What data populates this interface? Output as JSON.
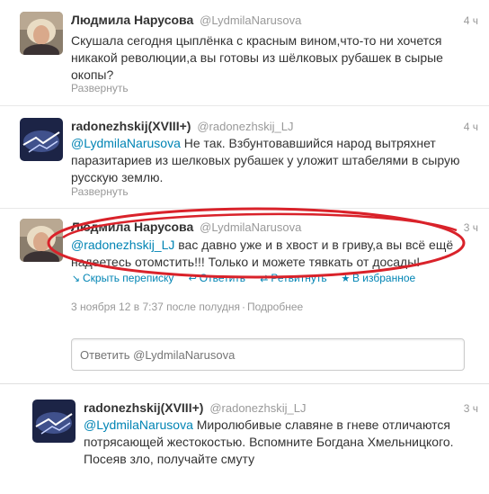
{
  "tweets": [
    {
      "fullname": "Людмила Нарусова",
      "username": "@LydmilaNarusova",
      "time": "4 ч",
      "mention": "",
      "text": "Скушала сегодня цыплёнка с красным вином,что-то ни хочется никакой революции,а вы готовы из шёлковых рубашек в сырые окопы?",
      "expand": "Развернуть"
    },
    {
      "fullname": "radonezhskij(XVIII+)",
      "username": "@radonezhskij_LJ",
      "time": "4 ч",
      "mention": "@LydmilaNarusova",
      "text": " Не так. Взбунтовавшийся народ вытряхнет паразитариев из шелковых рубашек у уложит штабелями в сырую русскую землю.",
      "expand": "Развернуть"
    },
    {
      "fullname": "Людмила Нарусова",
      "username": "@LydmilaNarusova",
      "time": "3 ч",
      "mention": "@radonezhskij_LJ",
      "text": " вас давно уже и в хвост и в гриву,а вы всё ещё надеетесь отомстить!!! Только и можете тявкать от досады!",
      "actions": {
        "hide": "Скрыть переписку",
        "reply": "Ответить",
        "retweet": "Ретвитнуть",
        "favorite": "В избранное"
      },
      "date": "3 ноября 12 в 7:37 после полудня",
      "details": "Подробнее",
      "reply_placeholder": "Ответить @LydmilaNarusova"
    },
    {
      "fullname": "radonezhskij(XVIII+)",
      "username": "@radonezhskij_LJ",
      "time": "3 ч",
      "mention": "@LydmilaNarusova",
      "text": " Миролюбивые славяне в гневе отличаются потрясающей жестокостью. Вспомните Богдана Хмельницкого. Посеяв зло, получайте смуту"
    }
  ],
  "colors": {
    "link": "#0084b4",
    "muted": "#999999",
    "highlight_ellipse": "#d9222a"
  },
  "icons": {
    "hide": "hide-conversation-icon",
    "reply": "reply-arrow-icon",
    "retweet": "retweet-icon",
    "favorite": "star-icon"
  }
}
